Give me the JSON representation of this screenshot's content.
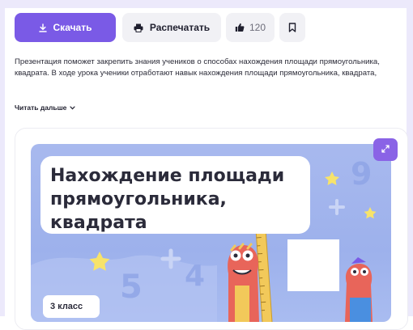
{
  "toolbar": {
    "download_label": "Скачать",
    "print_label": "Распечатать",
    "like_count": "120",
    "icons": {
      "download": "download-icon",
      "print": "printer-icon",
      "like": "thumbs-up-icon",
      "bookmark": "bookmark-icon"
    }
  },
  "description": {
    "line1": "Презентация поможет закрепить знания учеников о способах нахождения площади прямоугольника,",
    "line2": "квадрата. В ходе урока ученики отработают навык нахождения площади прямоугольника, квадрата,"
  },
  "read_more": {
    "label": "Читать дальше"
  },
  "slide": {
    "title_lines": [
      "Нахождение площади",
      "прямоугольника,",
      "квадрата"
    ],
    "grade": "3 класс"
  },
  "colors": {
    "accent": "#7a5ae6",
    "slide_bg": "#a8b9ee",
    "expand_button": "#8a63e6"
  }
}
